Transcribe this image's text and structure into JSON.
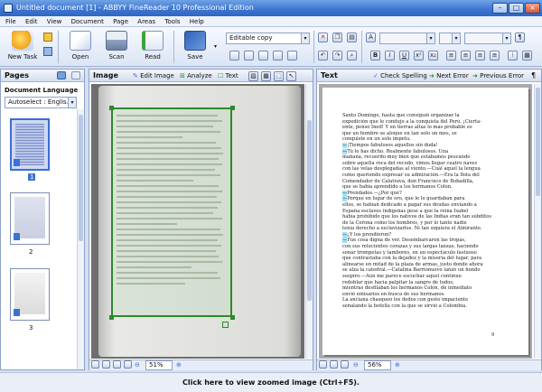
{
  "window": {
    "title": "Untitled document [1] - ABBYY FineReader 10 Professional Edition"
  },
  "menu": [
    "File",
    "Edit",
    "View",
    "Document",
    "Page",
    "Areas",
    "Tools",
    "Help"
  ],
  "toolbar": {
    "new_task": "New Task",
    "open": "Open",
    "scan": "Scan",
    "read": "Read",
    "save": "Save",
    "save_format": "Editable copy"
  },
  "pages_pane": {
    "title": "Pages",
    "doc_language_label": "Document Language",
    "language_value": "Autoselect : Englis...",
    "thumbnails": [
      {
        "num": "1"
      },
      {
        "num": "2"
      },
      {
        "num": "3"
      }
    ]
  },
  "image_pane": {
    "title": "Image",
    "edit_image": "Edit Image",
    "analyze": "Analyze",
    "text_btn": "Text",
    "zoom": "51%"
  },
  "text_pane": {
    "title": "Text",
    "check_spelling": "Check Spelling",
    "next_error": "Next Error",
    "previous_error": "Previous Error",
    "zoom": "56%",
    "page_number": "9",
    "lines": [
      "Santo Domingo, hasta que consiguió organizar la",
      "expedición que le condujo a la conquista del Perú. ¡Cierta-",
      "ente, pensó Ined! Y en tierras altas lo más probable es",
      "que un hombre se aloque en tan solo un mes, se",
      "conquiste en un solo impetu.",
      "—¡Tiempos fabulosos aquellos sin duda!",
      "—Tú lo has dicho. Realmente fabulosos. Una",
      "mañana, recuerdo muy bien que estábamos pescando",
      "sobre aquella roca del recodo, vimos llegar cuatro naves",
      "con las velas desplegadas al viento.—Cuál aquel la lengua",
      "como queriendo expresar su admiración.—Era la flota del",
      "Comendador de Calatrava, don Francisco de Bobadilla,",
      "que se había aprendido a los hermanos Colón.",
      "—Prendados.—¿Por qué?",
      "—Porque en lugar de oro, que le lo guardaban para",
      "ellos, se habían dedicado a pagar sus deudas enviando a",
      "España esclavos indígenas pese a que la reina Isabel",
      "había prohibido que los nativos de las Indias eran tan súbditos",
      "de la Corona como los hombres, y por lo tanto nadie",
      "tenía derecho a esclavizarlos. Ni tan siquiera el Almirante.",
      "—¿Y los prendieron?",
      "—Fue cosa digna de ver. Desembarcaron las tropas,",
      "con sus relucientes corazas y sus largas lanzas, haciendo",
      "sonar trompetas y tambores, en un espectáculo fastuoso",
      "que contrastaba con la dejadez y la miseria del lugar, para",
      "alinearse en mitad de la plaza de armas, justo donde ahora",
      "se alza la catedral.—Catalina Barrionuevo lanzó un hondo",
      "suspiro.—Aún me parece escuchar aquel continuo",
      "redoblar que hacía palpitar la sangre de todos,",
      "mientras desfilaban los hermanos Colón, de inmediato",
      "envió emisarios en busca de sus hermanos.",
      "La anciana chasqueó los dedos con gesto impaciente",
      "señalando la botella con la que se sirvió a Colombia."
    ]
  },
  "status": {
    "zoom_hint": "Click here to view zoomed image (Ctrl+F5)."
  },
  "colors": {
    "titlebar": "#3c74cf",
    "selection": "#2b8a2b",
    "highlight": "#9fe2f7"
  }
}
